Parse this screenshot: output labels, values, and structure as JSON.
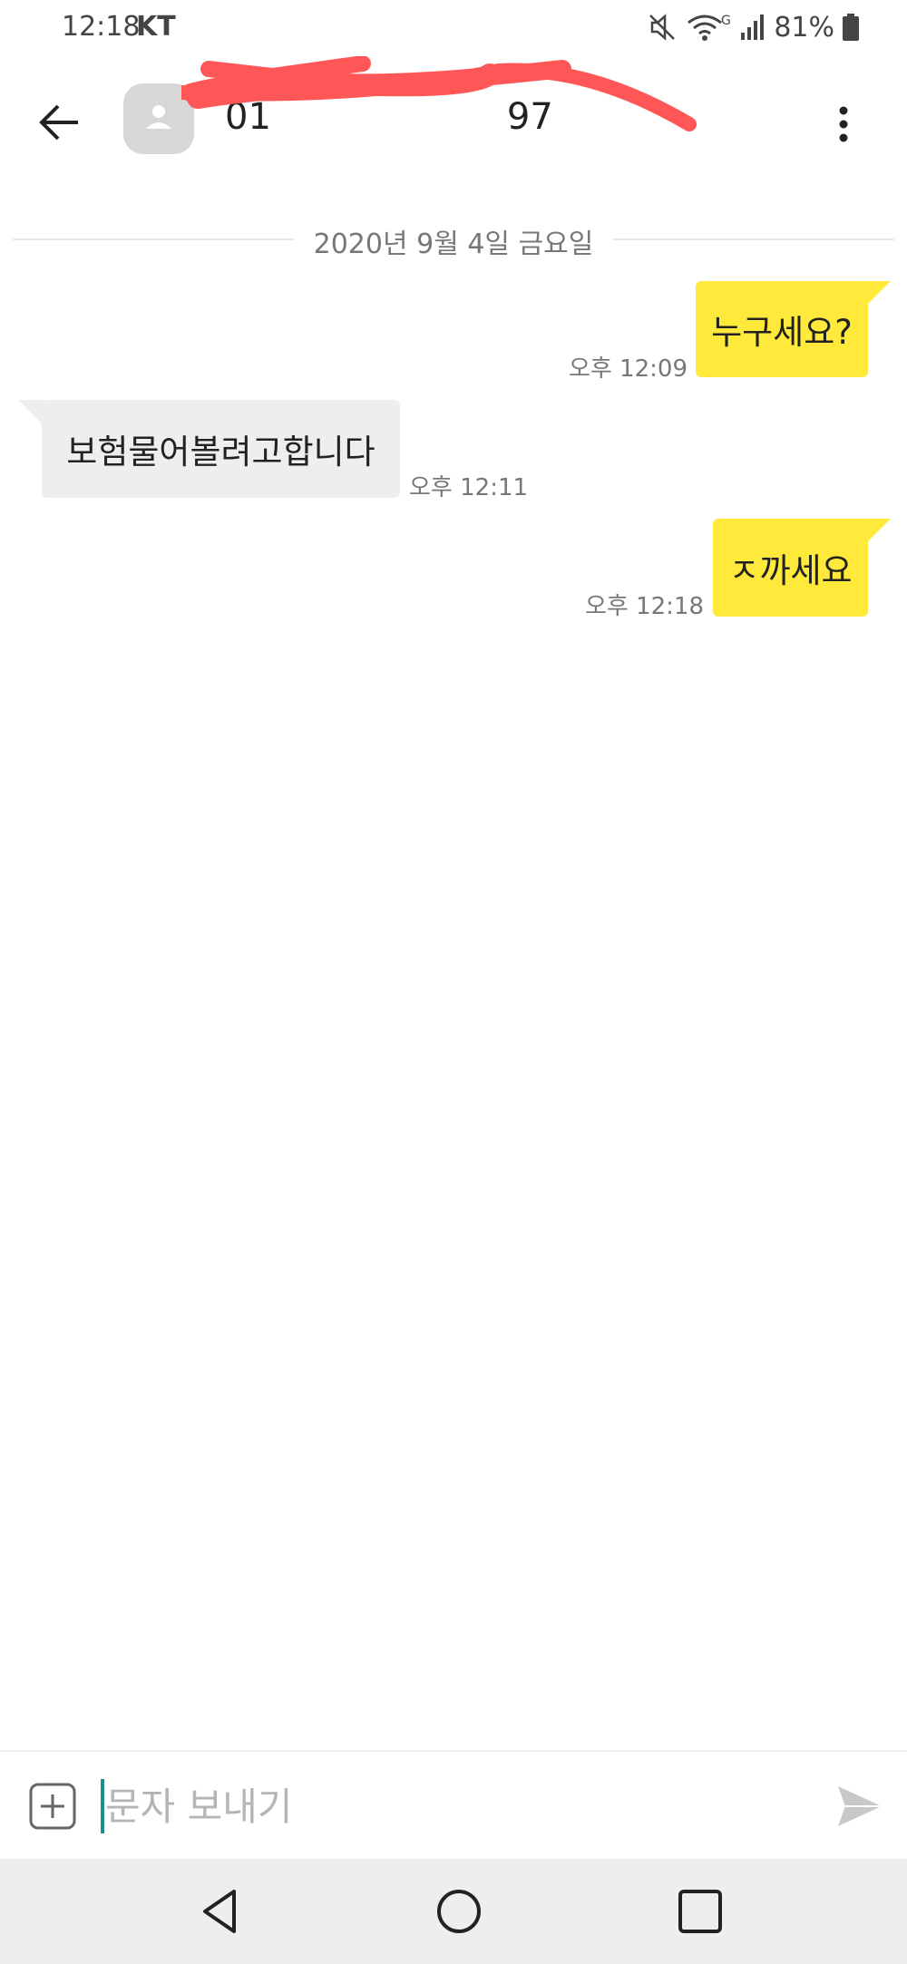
{
  "status_bar": {
    "time": "12:18",
    "carrier": "KT",
    "battery": "81%"
  },
  "header": {
    "title": "01",
    "title_suffix": "97",
    "back_icon": "arrow-left-icon",
    "avatar_icon": "person-icon",
    "menu_icon": "more-vertical-icon",
    "redaction_color": "#ff5757"
  },
  "conversation": {
    "date": "2020년 9월 4일 금요일",
    "messages": [
      {
        "direction": "outgoing",
        "text": "누구세요?",
        "time": "오후 12:09"
      },
      {
        "direction": "incoming",
        "text": "보험물어볼려고합니다",
        "time": "오후 12:11"
      },
      {
        "direction": "outgoing",
        "text": "ㅈ까세요",
        "time": "오후 12:18"
      }
    ]
  },
  "composer": {
    "placeholder": "문자 보내기",
    "attach_icon": "plus-box-icon",
    "send_icon": "send-icon",
    "cursor_color": "#1d8f8c"
  },
  "nav_bar": {
    "back_icon": "triangle-back-icon",
    "home_icon": "circle-home-icon",
    "recents_icon": "square-recents-icon"
  },
  "colors": {
    "outgoing_bubble": "#ffe93b",
    "incoming_bubble": "#eeeeee",
    "background": "#ffffff"
  }
}
